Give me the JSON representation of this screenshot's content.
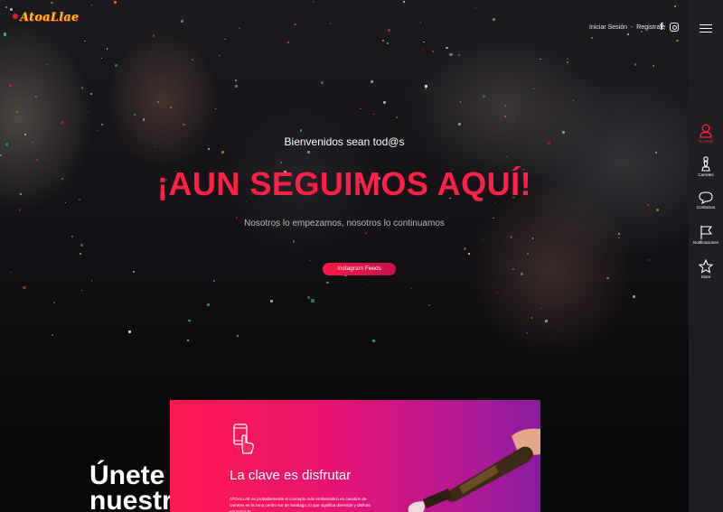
{
  "header": {
    "logo_text": "AtoaLlae",
    "login_label": "Iniciar Sesión",
    "separator": "-",
    "register_label": "Registrate",
    "facebook_icon": "facebook-icon",
    "instagram_icon": "instagram-icon"
  },
  "hero": {
    "welcome": "Bienvenidos sean tod@s",
    "headline": "¡AUN SEGUIMOS AQUÍ!",
    "subline": "Nosotros lo empezamos, nosotros lo continuamos",
    "cta_label": "Instagram Feeds"
  },
  "section": {
    "join_line1": "Únete a",
    "join_line2": "nuestra",
    "promo_title": "La clave es disfrutar",
    "promo_text": "ATOALLAE es probablemente el concepto más emblemático en cuestión de carretes en la zona centro sur de Santiago, lo que significa diversión y disfrute garantizado."
  },
  "rail": {
    "menu_icon": "menu-icon",
    "items": [
      {
        "label": "Tu Perfil",
        "icon": "user-icon",
        "active": true
      },
      {
        "label": "Carretes",
        "icon": "chess-pawn-icon",
        "active": false
      },
      {
        "label": "Contactos",
        "icon": "chat-bubble-icon",
        "active": false
      },
      {
        "label": "Notificaciones",
        "icon": "flag-icon",
        "active": false
      },
      {
        "label": "Store",
        "icon": "star-icon",
        "active": false
      }
    ]
  },
  "colors": {
    "accent": "#ff2046",
    "logo": "#f3c514",
    "promo_gradient_start": "#ff1a50",
    "promo_gradient_end": "#8a1c9e",
    "rail_bg": "#1f1e22"
  }
}
